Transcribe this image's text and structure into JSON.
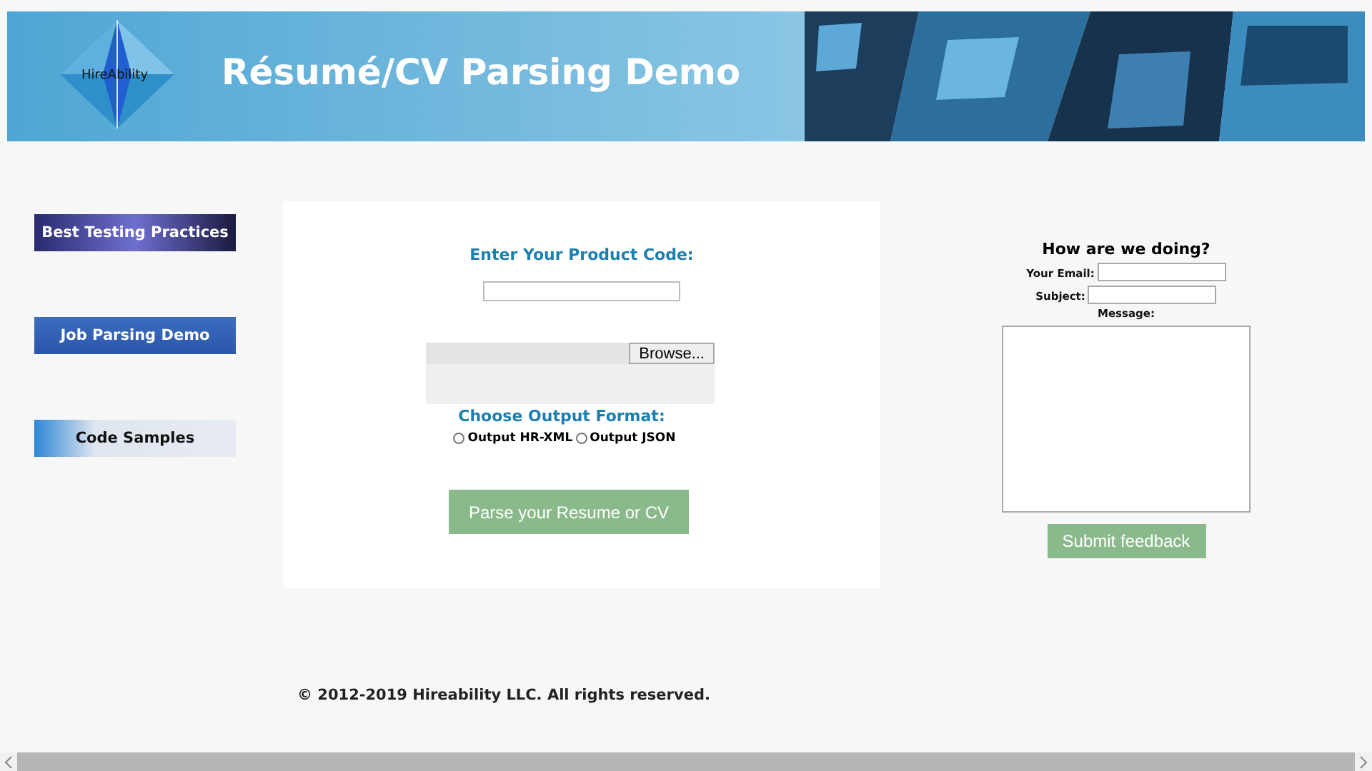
{
  "header": {
    "logo_text": "HireAbility",
    "title": "Résumé/CV Parsing Demo"
  },
  "sidebar": {
    "links": [
      {
        "label": "Best Testing Practices",
        "kind": "dark"
      },
      {
        "label": "Job Parsing Demo",
        "kind": "blue"
      },
      {
        "label": "Code Samples",
        "kind": "light"
      }
    ]
  },
  "form": {
    "product_code_label": "Enter Your Product Code:",
    "browse_button": "Browse...",
    "format_label": "Choose Output Format:",
    "formats": [
      {
        "label": "Output HR-XML",
        "selected": false
      },
      {
        "label": "Output JSON",
        "selected": false
      }
    ],
    "submit_button": "Parse your Resume or CV"
  },
  "feedback": {
    "title": "How are we doing?",
    "email_label": "Your Email:",
    "subject_label": "Subject:",
    "message_label": "Message:",
    "submit_button": "Submit feedback"
  },
  "footer": "© 2012-2019 Hireability LLC. All rights reserved."
}
